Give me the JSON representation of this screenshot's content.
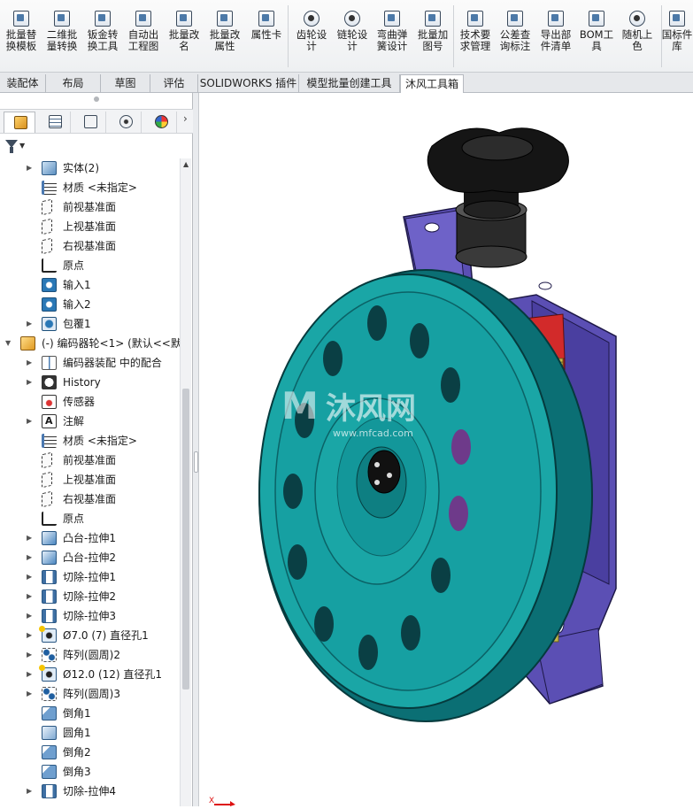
{
  "ribbon": {
    "buttons": [
      {
        "label": "批量替\n换模板",
        "icon": "batch-replace-template-icon"
      },
      {
        "label": "二维批\n量转换",
        "icon": "2d-batch-convert-icon"
      },
      {
        "label": "钣金转\n换工具",
        "icon": "sheetmetal-convert-icon"
      },
      {
        "label": "自动出\n工程图",
        "icon": "auto-drawing-icon"
      },
      {
        "label": "批量改\n名",
        "icon": "batch-rename-icon"
      },
      {
        "label": "批量改\n属性",
        "icon": "batch-property-icon"
      },
      {
        "label": "属性卡",
        "icon": "property-card-icon"
      },
      {
        "label": "齿轮设\n计",
        "icon": "gear-design-icon"
      },
      {
        "label": "链轮设\n计",
        "icon": "sprocket-design-icon"
      },
      {
        "label": "弯曲弹\n簧设计",
        "icon": "spring-design-icon"
      },
      {
        "label": "批量加\n图号",
        "icon": "batch-drawing-number-icon"
      },
      {
        "label": "技术要\n求管理",
        "icon": "tech-requirements-icon"
      },
      {
        "label": "公差查\n询标注",
        "icon": "tolerance-icon"
      },
      {
        "label": "导出部\n件清单",
        "icon": "export-parts-list-icon"
      },
      {
        "label": "BOM工\n具",
        "icon": "bom-tool-icon"
      },
      {
        "label": "随机上\n色",
        "icon": "random-color-icon"
      },
      {
        "label": "国标件\n库",
        "icon": "standard-parts-library-icon"
      }
    ]
  },
  "tabs": [
    {
      "label": "装配体",
      "active": false
    },
    {
      "label": "布局",
      "active": false
    },
    {
      "label": "草图",
      "active": false
    },
    {
      "label": "评估",
      "active": false
    },
    {
      "label": "SOLIDWORKS 插件",
      "active": false
    },
    {
      "label": "模型批量创建工具",
      "active": false
    },
    {
      "label": "沐风工具箱",
      "active": true
    }
  ],
  "panel_tabs": [
    {
      "name": "feature-manager-tab",
      "icon": "cube-icon"
    },
    {
      "name": "property-manager-tab",
      "icon": "list-icon"
    },
    {
      "name": "configuration-manager-tab",
      "icon": "config-icon"
    },
    {
      "name": "dimxpert-manager-tab",
      "icon": "crosshair-icon"
    },
    {
      "name": "display-manager-tab",
      "icon": "appearance-icon"
    }
  ],
  "panel_more": "›",
  "tree": [
    {
      "label": "实体(2)",
      "level": 1,
      "arrow": "▶",
      "icon": "i-solid",
      "iconName": "solid-bodies-icon"
    },
    {
      "label": "材质 <未指定>",
      "level": 1,
      "arrow": "",
      "icon": "i-mat",
      "iconName": "material-icon"
    },
    {
      "label": "前视基准面",
      "level": 1,
      "arrow": "",
      "icon": "i-plane",
      "iconName": "plane-icon"
    },
    {
      "label": "上视基准面",
      "level": 1,
      "arrow": "",
      "icon": "i-plane",
      "iconName": "plane-icon"
    },
    {
      "label": "右视基准面",
      "level": 1,
      "arrow": "",
      "icon": "i-plane",
      "iconName": "plane-icon"
    },
    {
      "label": "原点",
      "level": 1,
      "arrow": "",
      "icon": "i-origin",
      "iconName": "origin-icon"
    },
    {
      "label": "输入1",
      "level": 1,
      "arrow": "",
      "icon": "i-in",
      "iconName": "imported-body-icon"
    },
    {
      "label": "输入2",
      "level": 1,
      "arrow": "",
      "icon": "i-in",
      "iconName": "imported-body-icon"
    },
    {
      "label": "包覆1",
      "level": 1,
      "arrow": "▶",
      "icon": "i-wrap",
      "iconName": "wrap-feature-icon"
    },
    {
      "label": "(-) 编码器轮<1> (默认<<默",
      "level": 0,
      "arrow": "▼",
      "icon": "i-asm",
      "iconName": "part-component-icon"
    },
    {
      "label": "编码器装配 中的配合",
      "level": 1,
      "arrow": "▶",
      "icon": "i-mate",
      "iconName": "mates-icon"
    },
    {
      "label": "History",
      "level": 1,
      "arrow": "▶",
      "icon": "i-hist",
      "iconName": "history-icon"
    },
    {
      "label": "传感器",
      "level": 1,
      "arrow": "",
      "icon": "i-sens",
      "iconName": "sensors-icon"
    },
    {
      "label": "注解",
      "level": 1,
      "arrow": "▶",
      "icon": "i-note",
      "iconName": "annotations-icon"
    },
    {
      "label": "材质 <未指定>",
      "level": 1,
      "arrow": "",
      "icon": "i-mat",
      "iconName": "material-icon"
    },
    {
      "label": "前视基准面",
      "level": 1,
      "arrow": "",
      "icon": "i-plane",
      "iconName": "plane-icon"
    },
    {
      "label": "上视基准面",
      "level": 1,
      "arrow": "",
      "icon": "i-plane",
      "iconName": "plane-icon"
    },
    {
      "label": "右视基准面",
      "level": 1,
      "arrow": "",
      "icon": "i-plane",
      "iconName": "plane-icon"
    },
    {
      "label": "原点",
      "level": 1,
      "arrow": "",
      "icon": "i-origin",
      "iconName": "origin-icon"
    },
    {
      "label": "凸台-拉伸1",
      "level": 1,
      "arrow": "▶",
      "icon": "i-boss",
      "iconName": "boss-extrude-icon"
    },
    {
      "label": "凸台-拉伸2",
      "level": 1,
      "arrow": "▶",
      "icon": "i-boss",
      "iconName": "boss-extrude-icon"
    },
    {
      "label": "切除-拉伸1",
      "level": 1,
      "arrow": "▶",
      "icon": "i-cut",
      "iconName": "cut-extrude-icon"
    },
    {
      "label": "切除-拉伸2",
      "level": 1,
      "arrow": "▶",
      "icon": "i-cut",
      "iconName": "cut-extrude-icon"
    },
    {
      "label": "切除-拉伸3",
      "level": 1,
      "arrow": "▶",
      "icon": "i-cut",
      "iconName": "cut-extrude-icon"
    },
    {
      "label": "Ø7.0 (7) 直径孔1",
      "level": 1,
      "arrow": "▶",
      "icon": "i-hole",
      "iconName": "hole-wizard-icon"
    },
    {
      "label": "阵列(圆周)2",
      "level": 1,
      "arrow": "▶",
      "icon": "i-pat",
      "iconName": "circular-pattern-icon"
    },
    {
      "label": "Ø12.0 (12) 直径孔1",
      "level": 1,
      "arrow": "▶",
      "icon": "i-hole",
      "iconName": "hole-wizard-icon"
    },
    {
      "label": "阵列(圆周)3",
      "level": 1,
      "arrow": "▶",
      "icon": "i-pat",
      "iconName": "circular-pattern-icon"
    },
    {
      "label": "倒角1",
      "level": 1,
      "arrow": "",
      "icon": "i-cham",
      "iconName": "chamfer-icon"
    },
    {
      "label": "圆角1",
      "level": 1,
      "arrow": "",
      "icon": "i-fil",
      "iconName": "fillet-icon"
    },
    {
      "label": "倒角2",
      "level": 1,
      "arrow": "",
      "icon": "i-cham",
      "iconName": "chamfer-icon"
    },
    {
      "label": "倒角3",
      "level": 1,
      "arrow": "",
      "icon": "i-cham",
      "iconName": "chamfer-icon"
    },
    {
      "label": "切除-拉伸4",
      "level": 1,
      "arrow": "▶",
      "icon": "i-cut",
      "iconName": "cut-extrude-icon"
    }
  ],
  "viewport": {
    "watermark_main": "沐风网",
    "watermark_url": "www.mfcad.com",
    "colors": {
      "wheel": "#1aa6a6",
      "wheel_dark": "#0b6f74",
      "bracket": "#5b4fb4",
      "knob": "#151515",
      "spring": "#c8b84a",
      "slider": "#d22a2a"
    }
  },
  "triad": {
    "x_label": "X"
  }
}
